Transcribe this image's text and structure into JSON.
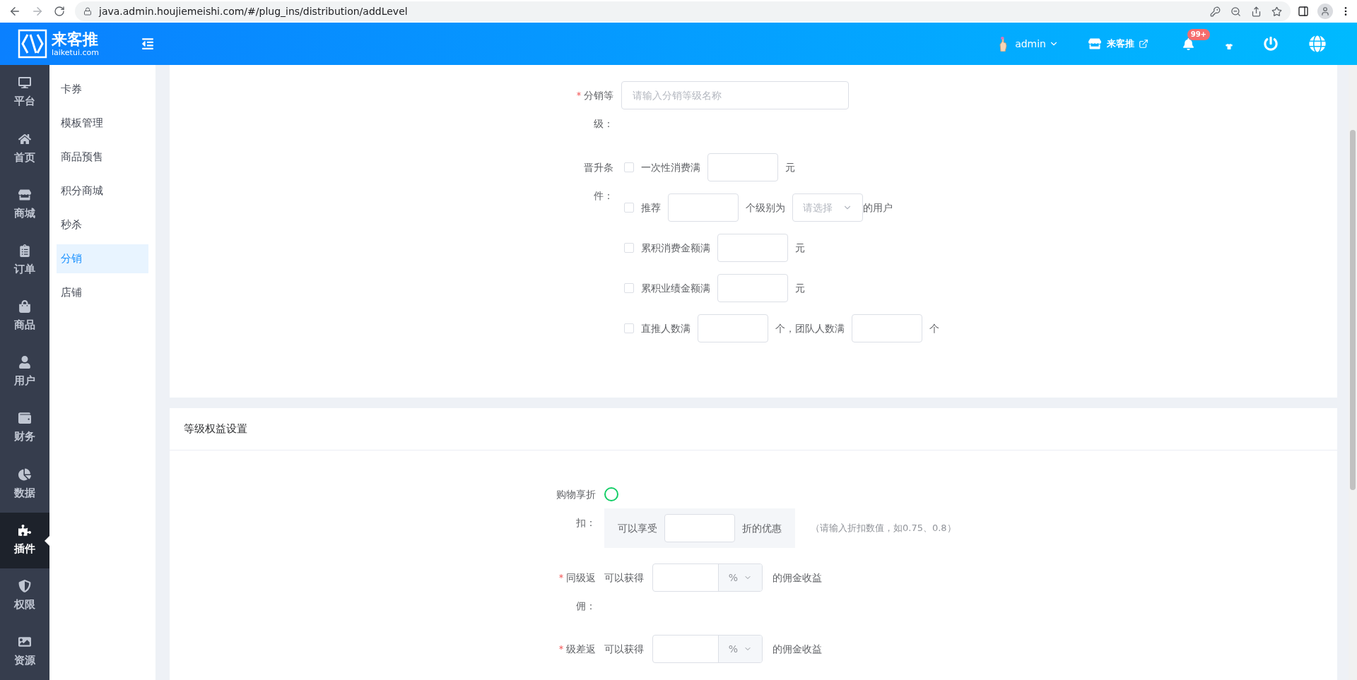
{
  "browser": {
    "url": "java.admin.houjiemeishi.com/#/plug_ins/distribution/addLevel"
  },
  "header": {
    "brand": "来客推",
    "domain": "laiketui.com",
    "user": "admin",
    "store": "来客推",
    "notifications": "99+"
  },
  "main_nav": [
    {
      "label": "平台",
      "selected": false
    },
    {
      "label": "首页",
      "selected": false
    },
    {
      "label": "商城",
      "selected": false
    },
    {
      "label": "订单",
      "selected": false
    },
    {
      "label": "商品",
      "selected": false
    },
    {
      "label": "用户",
      "selected": false
    },
    {
      "label": "财务",
      "selected": false
    },
    {
      "label": "数据",
      "selected": false
    },
    {
      "label": "插件",
      "selected": true
    },
    {
      "label": "权限",
      "selected": false
    },
    {
      "label": "资源",
      "selected": false
    }
  ],
  "sub_nav": [
    {
      "label": "卡券",
      "selected": false
    },
    {
      "label": "模板管理",
      "selected": false
    },
    {
      "label": "商品预售",
      "selected": false
    },
    {
      "label": "积分商城",
      "selected": false
    },
    {
      "label": "秒杀",
      "selected": false
    },
    {
      "label": "分销",
      "selected": true
    },
    {
      "label": "店铺",
      "selected": false
    }
  ],
  "level_name": {
    "label": "分销等级：",
    "required": true,
    "placeholder": "请输入分销等级名称"
  },
  "promotion": {
    "label": "晋升条件：",
    "conditions": [
      {
        "checked": false,
        "parts": [
          {
            "kind": "text",
            "text": "一次性消费满"
          },
          {
            "kind": "input"
          },
          {
            "kind": "text",
            "text": "元"
          }
        ]
      },
      {
        "checked": false,
        "parts": [
          {
            "kind": "text",
            "text": "推荐"
          },
          {
            "kind": "input"
          },
          {
            "kind": "text",
            "text": "个级别为"
          },
          {
            "kind": "select",
            "placeholder": "请选择"
          },
          {
            "kind": "text",
            "text": "的用户"
          }
        ]
      },
      {
        "checked": false,
        "parts": [
          {
            "kind": "text",
            "text": "累积消费金额满"
          },
          {
            "kind": "input"
          },
          {
            "kind": "text",
            "text": "元"
          }
        ]
      },
      {
        "checked": false,
        "parts": [
          {
            "kind": "text",
            "text": "累积业绩金额满"
          },
          {
            "kind": "input"
          },
          {
            "kind": "text",
            "text": "元"
          }
        ]
      },
      {
        "checked": false,
        "parts": [
          {
            "kind": "text",
            "text": "直推人数满"
          },
          {
            "kind": "input"
          },
          {
            "kind": "text",
            "text": "个，团队人数满"
          },
          {
            "kind": "input"
          },
          {
            "kind": "text",
            "text": "个"
          }
        ]
      }
    ]
  },
  "benefits": {
    "title": "等级权益设置",
    "discount": {
      "label": "购物享折扣：",
      "checked": false,
      "prefix": "可以享受",
      "suffix": "折的优惠",
      "hint": "（请输入折扣数值，如0.75、0.8）"
    },
    "commissions": [
      {
        "label": "同级返佣：",
        "required": true,
        "prefix": "可以获得",
        "unit": "%",
        "suffix": "的佣金收益"
      },
      {
        "label": "级差返",
        "required": true,
        "prefix": "可以获得",
        "unit": "%",
        "suffix": "的佣金收益"
      }
    ]
  }
}
